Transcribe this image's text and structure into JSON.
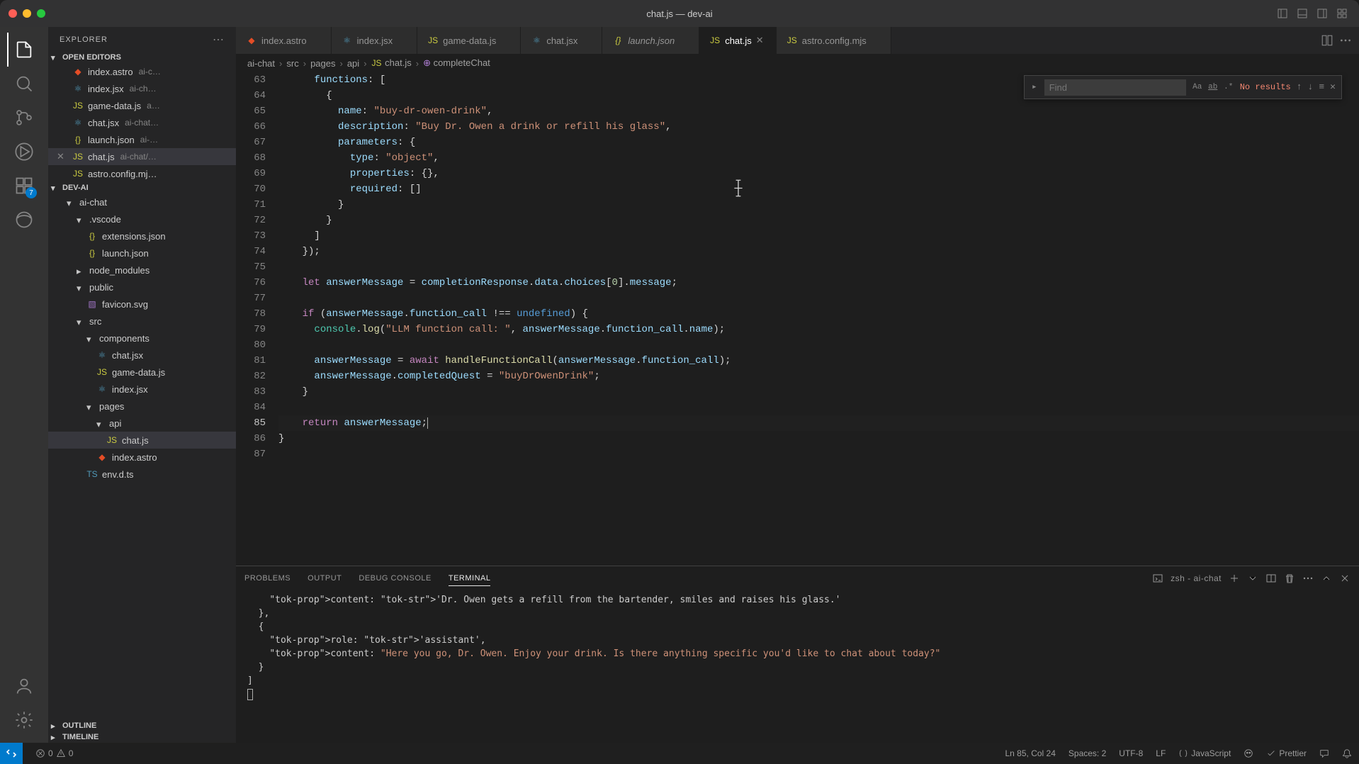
{
  "window": {
    "title": "chat.js — dev-ai"
  },
  "explorer": {
    "title": "EXPLORER",
    "openEditorsLabel": "OPEN EDITORS",
    "projectLabel": "DEV-AI",
    "outlineLabel": "OUTLINE",
    "timelineLabel": "TIMELINE",
    "openEditors": [
      {
        "name": "index.astro",
        "tail": "ai-c…"
      },
      {
        "name": "index.jsx",
        "tail": "ai-ch…"
      },
      {
        "name": "game-data.js",
        "tail": "a…"
      },
      {
        "name": "chat.jsx",
        "tail": "ai-chat…"
      },
      {
        "name": "launch.json",
        "tail": "ai-…"
      },
      {
        "name": "chat.js",
        "tail": "ai-chat/…",
        "active": true
      },
      {
        "name": "astro.config.mj…",
        "tail": ""
      }
    ],
    "tree": [
      {
        "type": "folder",
        "name": "ai-chat",
        "depth": 1,
        "open": true
      },
      {
        "type": "folder",
        "name": ".vscode",
        "depth": 2,
        "open": true
      },
      {
        "type": "file",
        "name": "extensions.json",
        "depth": 3,
        "icon": "json"
      },
      {
        "type": "file",
        "name": "launch.json",
        "depth": 3,
        "icon": "json"
      },
      {
        "type": "folder",
        "name": "node_modules",
        "depth": 2,
        "open": false
      },
      {
        "type": "folder",
        "name": "public",
        "depth": 2,
        "open": true
      },
      {
        "type": "file",
        "name": "favicon.svg",
        "depth": 3,
        "icon": "svg"
      },
      {
        "type": "folder",
        "name": "src",
        "depth": 2,
        "open": true
      },
      {
        "type": "folder",
        "name": "components",
        "depth": 3,
        "open": true
      },
      {
        "type": "file",
        "name": "chat.jsx",
        "depth": 4,
        "icon": "jsx"
      },
      {
        "type": "file",
        "name": "game-data.js",
        "depth": 4,
        "icon": "js"
      },
      {
        "type": "file",
        "name": "index.jsx",
        "depth": 4,
        "icon": "jsx"
      },
      {
        "type": "folder",
        "name": "pages",
        "depth": 3,
        "open": true
      },
      {
        "type": "folder",
        "name": "api",
        "depth": 4,
        "open": true
      },
      {
        "type": "file",
        "name": "chat.js",
        "depth": 5,
        "icon": "js",
        "active": true
      },
      {
        "type": "file",
        "name": "index.astro",
        "depth": 4,
        "icon": "astro"
      },
      {
        "type": "file",
        "name": "env.d.ts",
        "depth": 3,
        "icon": "ts"
      }
    ]
  },
  "tabs": [
    {
      "label": "index.astro",
      "icon": "astro"
    },
    {
      "label": "index.jsx",
      "icon": "jsx"
    },
    {
      "label": "game-data.js",
      "icon": "js"
    },
    {
      "label": "chat.jsx",
      "icon": "jsx"
    },
    {
      "label": "launch.json",
      "icon": "json",
      "italic": true
    },
    {
      "label": "chat.js",
      "icon": "js",
      "active": true
    },
    {
      "label": "astro.config.mjs",
      "icon": "js"
    }
  ],
  "breadcrumbs": [
    "ai-chat",
    "src",
    "pages",
    "api",
    "chat.js",
    "completeChat"
  ],
  "find": {
    "placeholder": "Find",
    "results": "No results"
  },
  "code": {
    "startLine": 63,
    "lines": [
      "      functions: [",
      "        {",
      "          name: \"buy-dr-owen-drink\",",
      "          description: \"Buy Dr. Owen a drink or refill his glass\",",
      "          parameters: {",
      "            type: \"object\",",
      "            properties: {},",
      "            required: []",
      "          }",
      "        }",
      "      ]",
      "    });",
      "",
      "    let answerMessage = completionResponse.data.choices[0].message;",
      "",
      "    if (answerMessage.function_call !== undefined) {",
      "      console.log(\"LLM function call: \", answerMessage.function_call.name);",
      "",
      "      answerMessage = await handleFunctionCall(answerMessage.function_call);",
      "      answerMessage.completedQuest = \"buyDrOwenDrink\";",
      "    }",
      "",
      "    return answerMessage;",
      "}",
      ""
    ],
    "activeLine": 85
  },
  "panel": {
    "tabs": [
      "PROBLEMS",
      "OUTPUT",
      "DEBUG CONSOLE",
      "TERMINAL"
    ],
    "activeTab": 3,
    "terminalName": "zsh - ai-chat",
    "terminalLines": [
      "    content: 'Dr. Owen gets a refill from the bartender, smiles and raises his glass.'",
      "  },",
      "  {",
      "    role: 'assistant',",
      "    content: \"Here you go, Dr. Owen. Enjoy your drink. Is there anything specific you'd like to chat about today?\"",
      "  }",
      "]"
    ]
  },
  "status": {
    "errors": "0",
    "warnings": "0",
    "cursor": "Ln 85, Col 24",
    "spaces": "Spaces: 2",
    "encoding": "UTF-8",
    "eol": "LF",
    "lang": "JavaScript",
    "prettier": "Prettier"
  },
  "activity": {
    "extBadge": "7"
  }
}
